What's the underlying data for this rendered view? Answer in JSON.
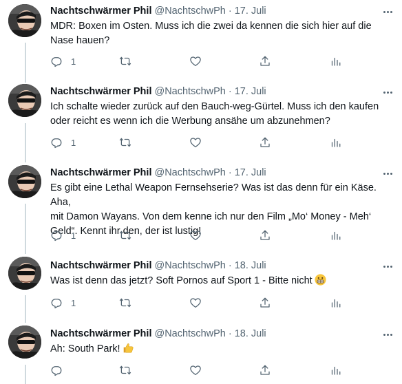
{
  "author": {
    "name": "Nachtschwärmer Phil",
    "handle": "@NachtschwPh",
    "separator": "·"
  },
  "icons": {
    "reply": "reply-icon",
    "retweet": "retweet-icon",
    "like": "heart-icon",
    "share": "share-icon",
    "analytics": "analytics-icon",
    "more": "more-icon",
    "grimace": "grimacing-face-emoji",
    "thumbs": "thumbs-up-emoji"
  },
  "colors": {
    "text": "#0f1419",
    "muted": "#536471",
    "thread_line": "#cfd9de"
  },
  "tweets": [
    {
      "date": "17. Juli",
      "text_lines": [
        "MDR: Boxen im Osten. Muss ich die zwei da kennen die sich hier auf die",
        "Nase hauen?"
      ],
      "reply_count": "1"
    },
    {
      "date": "17. Juli",
      "text_lines": [
        "Ich schalte wieder zurück auf den Bauch-weg-Gürtel. Muss ich den kaufen",
        "oder reicht es wenn ich die Werbung ansähe um abzunehmen?"
      ],
      "reply_count": "1"
    },
    {
      "date": "17. Juli",
      "text_lines": [
        "Es gibt eine Lethal Weapon Fernsehserie? Was ist das denn für ein Käse. Aha,",
        "mit Damon Wayans. Von dem kenne ich nur den Film „Mo‘ Money - Meh‘",
        "Geld“. Kennt ihr den, der ist lustig!"
      ],
      "reply_count": "1"
    },
    {
      "date": "18. Juli",
      "text_lines": [
        "Was ist denn das jetzt? Soft Pornos auf Sport 1 - Bitte nicht"
      ],
      "reply_count": "1"
    },
    {
      "date": "18. Juli",
      "text_lines": [
        "Ah: South Park!"
      ],
      "reply_count": ""
    }
  ]
}
